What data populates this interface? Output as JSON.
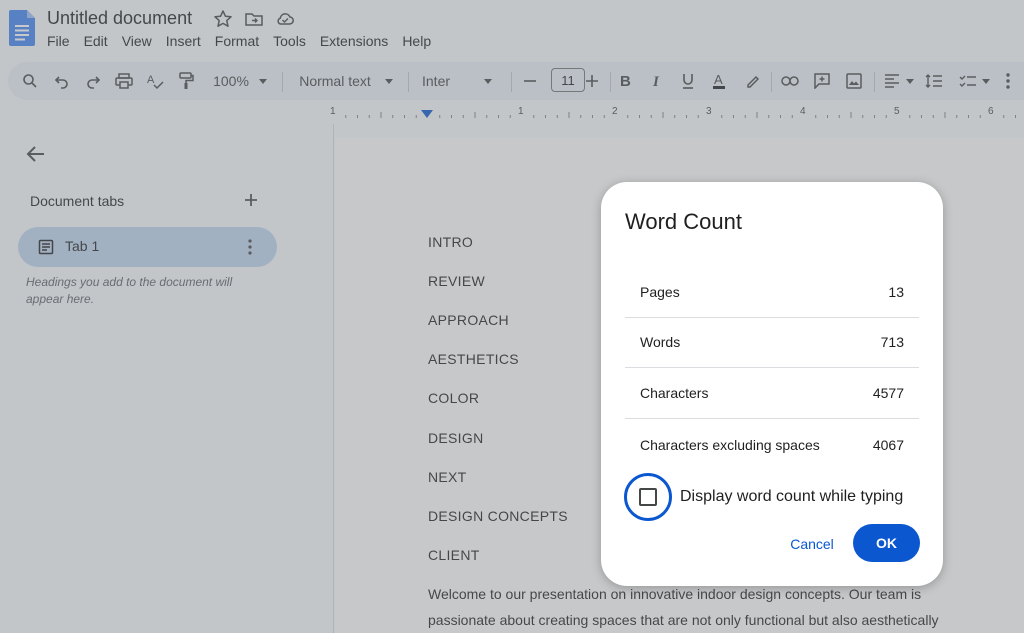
{
  "window": {
    "doc_title": "Untitled document"
  },
  "menu": [
    "File",
    "Edit",
    "View",
    "Insert",
    "Format",
    "Tools",
    "Extensions",
    "Help"
  ],
  "toolbar": {
    "zoom": "100%",
    "style": "Normal text",
    "font": "Inter",
    "font_size": "11"
  },
  "ruler": [
    "1",
    "1",
    "2",
    "3",
    "4",
    "5",
    "6"
  ],
  "sidebar": {
    "heading": "Document tabs",
    "tab_label": "Tab 1",
    "hint": "Headings you add to the document will appear here."
  },
  "document": {
    "headings": [
      "INTRO",
      "REVIEW",
      "APPROACH",
      "AESTHETICS",
      "COLOR",
      "DESIGN",
      "NEXT",
      "DESIGN CONCEPTS",
      "CLIENT"
    ],
    "body_line1": "Welcome to our presentation on innovative indoor design concepts. Our team is",
    "body_line2": "passionate about creating spaces that are not only functional but also aesthetically"
  },
  "dialog": {
    "title": "Word Count",
    "stats": [
      {
        "label": "Pages",
        "value": "13"
      },
      {
        "label": "Words",
        "value": "713"
      },
      {
        "label": "Characters",
        "value": "4577"
      },
      {
        "label": "Characters excluding spaces",
        "value": "4067"
      }
    ],
    "checkbox_label": "Display word count while typing",
    "checkbox_checked": false,
    "cancel": "Cancel",
    "ok": "OK"
  },
  "colors": {
    "accent": "#0b57d0",
    "tab_selected": "#c2d7f2",
    "toolbar_bg": "#edf2fa"
  }
}
